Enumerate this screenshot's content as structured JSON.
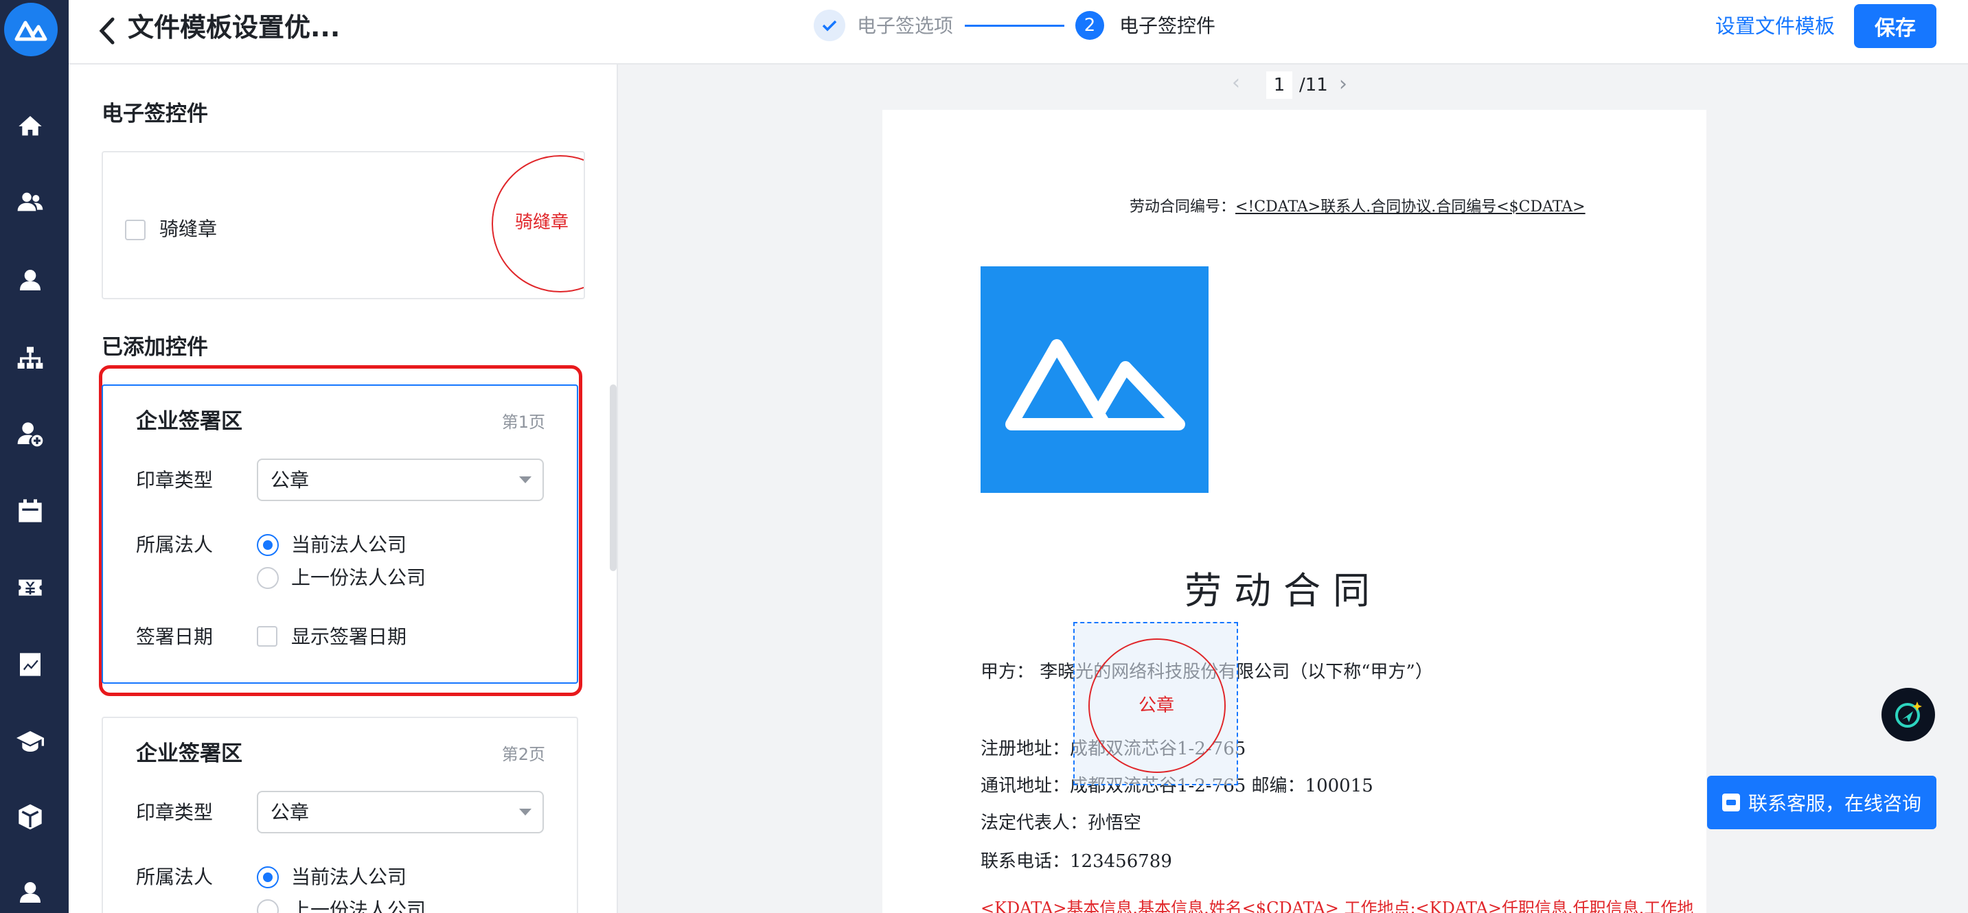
{
  "header": {
    "title": "文件模板设置优...",
    "steps": [
      {
        "label": "电子签选项",
        "status": "done"
      },
      {
        "number": "2",
        "label": "电子签控件",
        "status": "active"
      }
    ],
    "set_template_label": "设置文件模板",
    "save_label": "保存"
  },
  "nav": {
    "items": [
      "home-icon",
      "team-icon",
      "person-icon",
      "org-chart-icon",
      "add-user-icon",
      "calendar-icon",
      "yen-ticket-icon",
      "report-icon",
      "graduation-cap-icon",
      "cube-icon",
      "person-bottom-icon"
    ]
  },
  "panel": {
    "controls_title": "电子签控件",
    "seam_seal_label": "骑缝章",
    "seam_seal_stamp_text": "骑缝章",
    "added_title": "已添加控件",
    "cards": [
      {
        "title": "企业签署区",
        "page": "第1页",
        "seal_type_label": "印章类型",
        "seal_type_value": "公章",
        "entity_label": "所属法人",
        "entity_options": [
          "当前法人公司",
          "上一份法人公司"
        ],
        "entity_selected": 0,
        "date_label": "签署日期",
        "date_option": "显示签署日期"
      },
      {
        "title": "企业签署区",
        "page": "第2页",
        "seal_type_label": "印章类型",
        "seal_type_value": "公章",
        "entity_label": "所属法人",
        "entity_options": [
          "当前法人公司",
          "上一份法人公司"
        ],
        "entity_selected": 0
      }
    ]
  },
  "pager": {
    "current": "1",
    "total": "/11"
  },
  "document": {
    "contract_no_label": "劳动合同编号：",
    "contract_no_value": "<!CDATA>联系人.合同协议.合同编号<$CDATA>",
    "title": "劳动合同",
    "party_a": "甲方：  李晓光的网络科技股份有限公司（以下称“甲方”）",
    "reg_address": "注册地址：成都双流芯谷1-2-765",
    "mail_address": "通讯地址：成都双流芯谷1-2-765    邮编：100015",
    "legal_rep": "法定代表人：孙悟空",
    "phone": "联系电话：123456789",
    "red_line": "<KDATA>基本信息.基本信息.姓名<$CDATA>  工作地点:<KDATA>任职信息.任职信息.工作地"
  },
  "sign_stamp_text": "公章",
  "support_label": "联系客服，在线咨询",
  "colors": {
    "accent": "#1677ff",
    "seal_red": "#e0262a",
    "nav_bg": "#1d2a48",
    "highlight_red": "#e8191c"
  }
}
